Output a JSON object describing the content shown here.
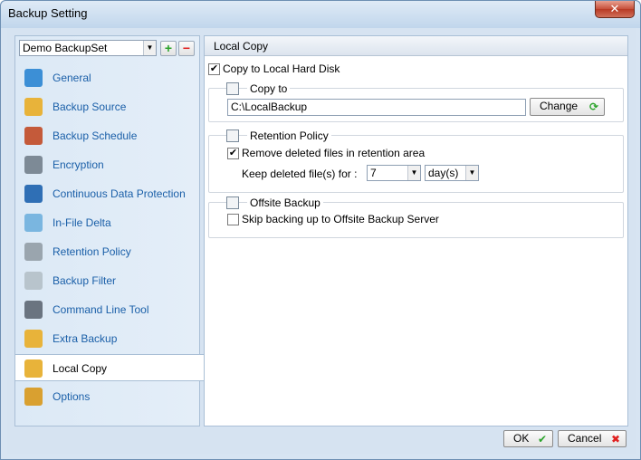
{
  "window": {
    "title": "Backup Setting",
    "close_glyph": "✕"
  },
  "sidebar": {
    "backupset_selected": "Demo BackupSet",
    "add_glyph": "+",
    "remove_glyph": "−",
    "items": [
      {
        "label": "General",
        "icon": "general-icon",
        "color": "#3c8fd6"
      },
      {
        "label": "Backup Source",
        "icon": "folder-icon",
        "color": "#e8b33a"
      },
      {
        "label": "Backup Schedule",
        "icon": "schedule-icon",
        "color": "#c45a3a"
      },
      {
        "label": "Encryption",
        "icon": "encryption-icon",
        "color": "#7d8a96"
      },
      {
        "label": "Continuous Data Protection",
        "icon": "shield-icon",
        "color": "#2f6fb5"
      },
      {
        "label": "In-File Delta",
        "icon": "delta-icon",
        "color": "#7ab6e0"
      },
      {
        "label": "Retention Policy",
        "icon": "recycle-bin-icon",
        "color": "#9aa5ae"
      },
      {
        "label": "Backup Filter",
        "icon": "filter-icon",
        "color": "#b8c4cc"
      },
      {
        "label": "Command Line Tool",
        "icon": "command-line-icon",
        "color": "#6a7480"
      },
      {
        "label": "Extra Backup",
        "icon": "extra-backup-icon",
        "color": "#e8b33a"
      },
      {
        "label": "Local Copy",
        "icon": "local-copy-icon",
        "color": "#e8b33a"
      },
      {
        "label": "Options",
        "icon": "options-icon",
        "color": "#d9a030"
      }
    ],
    "active_index": 10
  },
  "panel": {
    "header": "Local Copy",
    "copy_to_local": {
      "label": "Copy to Local Hard Disk",
      "checked": true
    },
    "copy_to": {
      "title": "Copy to",
      "path": "C:\\LocalBackup",
      "change_label": "Change",
      "change_icon_glyph": "⟳"
    },
    "retention": {
      "title": "Retention Policy",
      "remove_label": "Remove deleted files in retention area",
      "remove_checked": true,
      "keep_label": "Keep deleted file(s) for :",
      "keep_value": "7",
      "keep_unit": "day(s)"
    },
    "offsite": {
      "title": "Offsite Backup",
      "skip_label": "Skip backing up to Offsite Backup Server",
      "skip_checked": false
    }
  },
  "footer": {
    "ok_label": "OK",
    "ok_glyph": "✔",
    "cancel_label": "Cancel",
    "cancel_glyph": "✖"
  },
  "colors": {
    "accent_link": "#1a5fa8",
    "ok_green": "#2aa32a",
    "cancel_red": "#e02020"
  }
}
